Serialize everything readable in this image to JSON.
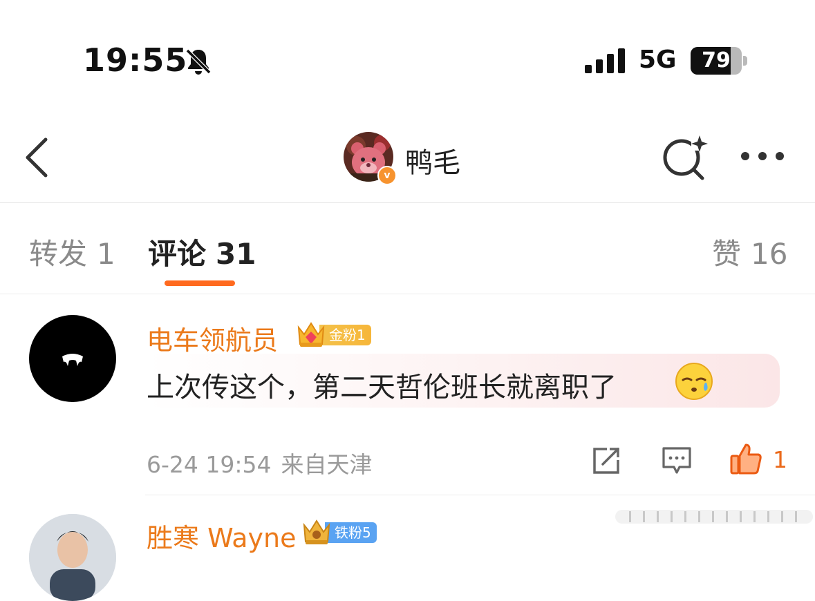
{
  "status_bar": {
    "time": "19:55",
    "network": "5G",
    "battery": "79",
    "battery_level": 0.79,
    "icons": [
      "bell-muted-icon",
      "cellular-signal-icon"
    ]
  },
  "header": {
    "title": "鸭毛",
    "verified_mark": "v",
    "icons": [
      "back-chevron-icon",
      "ai-search-icon",
      "more-dots-icon"
    ]
  },
  "tabs": [
    {
      "label": "转发",
      "count": "1",
      "active": false
    },
    {
      "label": "评论",
      "count": "31",
      "active": true
    },
    {
      "label": "赞",
      "count": "16",
      "active": false
    }
  ],
  "colors": {
    "accent": "#ff6a1f",
    "username": "#eb7a1b",
    "meta": "#9a9a9a",
    "gold_badge": "#f4c24a",
    "iron_badge": "#5aa3f2"
  },
  "comments": [
    {
      "username": "电车领航员",
      "badge": "金粉1",
      "text": "上次传这个，第二天哲伦班长就离职了",
      "emoji_icon": "sweat-emoji-icon",
      "date": "6-24 19:54",
      "location": "来自天津",
      "likes": "1"
    },
    {
      "username": "胜寒 Wayne",
      "badge": "铁粉5"
    }
  ]
}
